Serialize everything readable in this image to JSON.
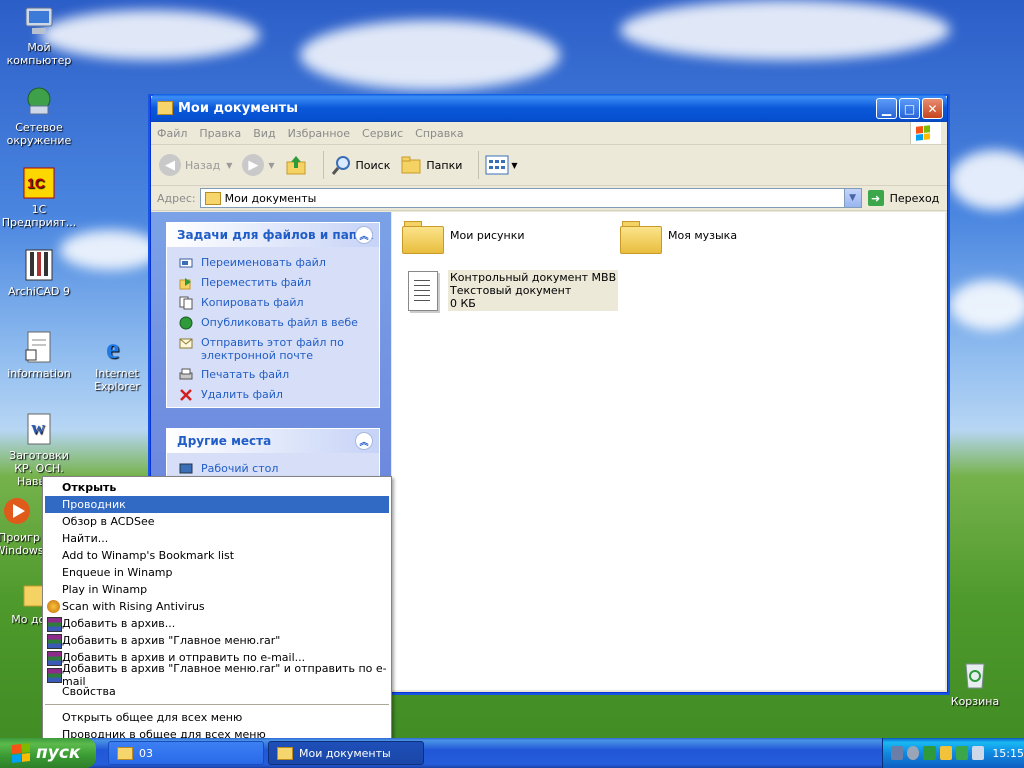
{
  "desktop": {
    "icons": [
      {
        "label": "Мой компьютер"
      },
      {
        "label": "Сетевое окружение"
      },
      {
        "label": "1С Предприят..."
      },
      {
        "label": "ArchiCAD 9"
      },
      {
        "label": "information"
      },
      {
        "label": "Internet Explorer"
      },
      {
        "label": "Заготовки КР. ОСН. Навыки"
      },
      {
        "label": "Проигр Windows"
      },
      {
        "label": "Мо докум"
      },
      {
        "label": "Корзина"
      }
    ]
  },
  "window": {
    "title": "Мои документы",
    "menu": [
      "Файл",
      "Правка",
      "Вид",
      "Избранное",
      "Сервис",
      "Справка"
    ],
    "toolbar": {
      "back": "Назад",
      "search": "Поиск",
      "folders": "Папки"
    },
    "address": {
      "label": "Адрес:",
      "value": "Мои документы",
      "go": "Переход"
    },
    "tasks": {
      "title": "Задачи для файлов и папок",
      "items": [
        "Переименовать файл",
        "Переместить файл",
        "Копировать файл",
        "Опубликовать файл в вебе",
        "Отправить этот файл по электронной почте",
        "Печатать файл",
        "Удалить файл"
      ]
    },
    "other_places": {
      "title": "Другие места",
      "items": [
        "Рабочий стол"
      ]
    },
    "files": [
      {
        "name": "Мои рисунки"
      },
      {
        "name": "Моя музыка"
      },
      {
        "name": "Контрольный документ МВВ",
        "type": "Текстовый документ",
        "size": "0 КБ"
      }
    ]
  },
  "context_menu": {
    "items": [
      "Открыть",
      "Проводник",
      "Обзор в ACDSee",
      "Найти...",
      "Add to Winamp's Bookmark list",
      "Enqueue in Winamp",
      "Play in Winamp",
      "Scan with Rising Antivirus",
      "Добавить в архив...",
      "Добавить в архив \"Главное меню.rar\"",
      "Добавить в архив и отправить по e-mail...",
      "Добавить в архив \"Главное меню.rar\" и отправить по e-mail",
      "Свойства",
      "Открыть общее для всех меню",
      "Проводник в общее для всех меню"
    ],
    "selected": "Проводник"
  },
  "taskbar": {
    "start": "пуск",
    "tasks": [
      "03",
      "Мои документы"
    ],
    "clock": "15:15"
  }
}
